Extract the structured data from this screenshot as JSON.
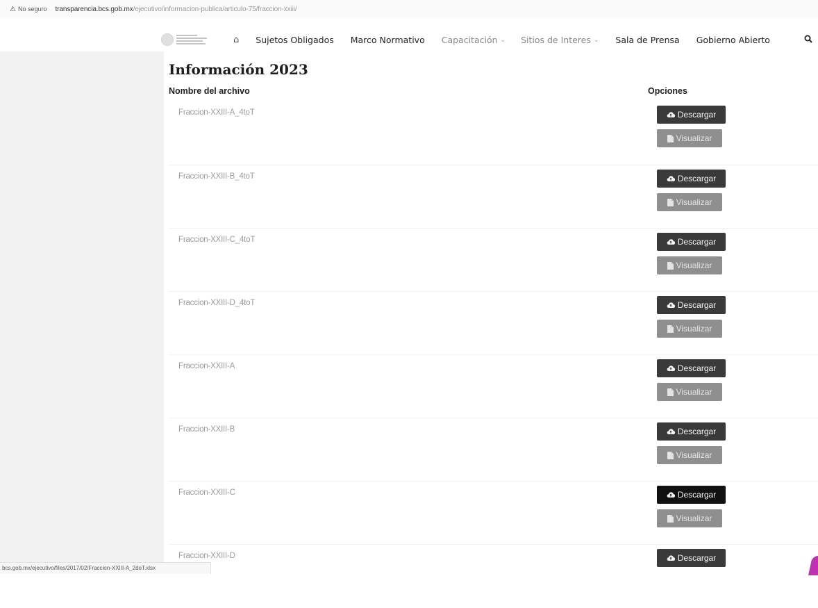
{
  "browser": {
    "security_label": "No seguro",
    "url_host": "transparencia.bcs.gob.mx",
    "url_path": "/ejecutivo/informacion-publica/articulo-75/fraccion-xxiii/",
    "status_url": "bcs.gob.mx/ejecutivo/files/2017/02/Fraccion-XXIII-A_2doT.xlsx"
  },
  "nav": {
    "items": [
      {
        "label": "Sujetos Obligados"
      },
      {
        "label": "Marco Normativo"
      },
      {
        "label": "Capacitación"
      },
      {
        "label": "Sitios de Interes"
      },
      {
        "label": "Sala de Prensa"
      },
      {
        "label": "Gobierno Abierto"
      }
    ]
  },
  "main": {
    "title": "Información 2023",
    "col_name": "Nombre del archivo",
    "col_options": "Opciones",
    "download_label": "Descargar",
    "view_label": "Visualizar",
    "files": [
      {
        "name": "Fraccion-XXIII-A_4toT"
      },
      {
        "name": "Fraccion-XXIII-B_4toT"
      },
      {
        "name": "Fraccion-XXIII-C_4toT"
      },
      {
        "name": "Fraccion-XXIII-D_4toT"
      },
      {
        "name": "Fraccion-XXIII-A"
      },
      {
        "name": "Fraccion-XXIII-B"
      },
      {
        "name": "Fraccion-XXIII-C"
      },
      {
        "name": "Fraccion-XXIII-D"
      }
    ]
  },
  "colors": {
    "download_bg": "#3a3a3a",
    "download_active_bg": "#111111",
    "view_bg": "#8f8f8f",
    "accent": "#c22fb5"
  },
  "icons": {
    "security": "warning-triangle-icon",
    "home": "home-icon",
    "search": "search-icon",
    "download": "cloud-upload-icon",
    "view": "file-icon"
  }
}
